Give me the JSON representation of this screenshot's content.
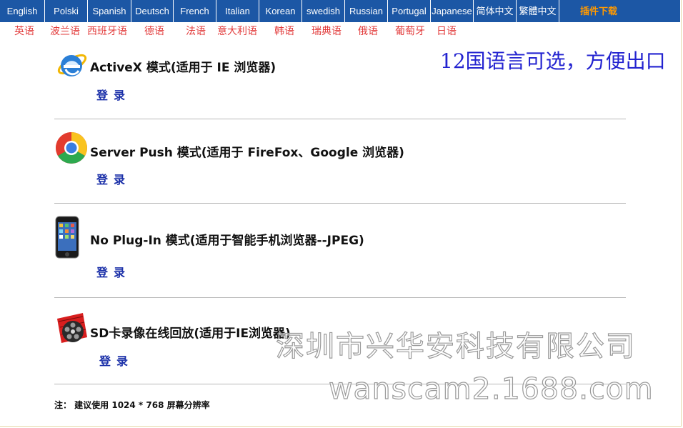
{
  "language_bar": {
    "items": [
      "English",
      "Polski",
      "Spanish",
      "Deutsch",
      "French",
      "Italian",
      "Korean",
      "swedish",
      "Russian",
      "Portugal",
      "Japanese",
      "简体中文",
      "繁體中文"
    ],
    "download": "插件下载"
  },
  "language_names_cn": [
    "英语",
    "波兰语",
    "西班牙语",
    "德语",
    "法语",
    "意大利语",
    "韩语",
    "瑞典语",
    "俄语",
    "葡萄牙",
    "日语"
  ],
  "tagline": "12国语言可选，方便出口",
  "sections": [
    {
      "icon": "ie-browser-icon",
      "title": "ActiveX 模式(适用于  IE 浏览器)",
      "login": "登录"
    },
    {
      "icon": "chrome-browser-icon",
      "title": "Server Push 模式(适用于  FireFox、Google 浏览器)",
      "login": "登录"
    },
    {
      "icon": "smartphone-icon",
      "title": "No Plug-In 模式(适用于智能手机浏览器--JPEG)",
      "login": "登录"
    },
    {
      "icon": "film-reel-icon",
      "title": "SD卡录像在线回放(适用于IE浏览器)",
      "login": "登录"
    }
  ],
  "watermark": {
    "company": "深圳市兴华安科技有限公司",
    "site": "wanscam2.1688.com"
  },
  "note": "注：  建议使用   1024 * 768 屏幕分辨率",
  "colors": {
    "bar_bg": "#1c57a5",
    "download_text": "#ff9900",
    "cn_names": "#e23a3a",
    "tagline": "#2323d0",
    "login": "#1a2fa8"
  }
}
